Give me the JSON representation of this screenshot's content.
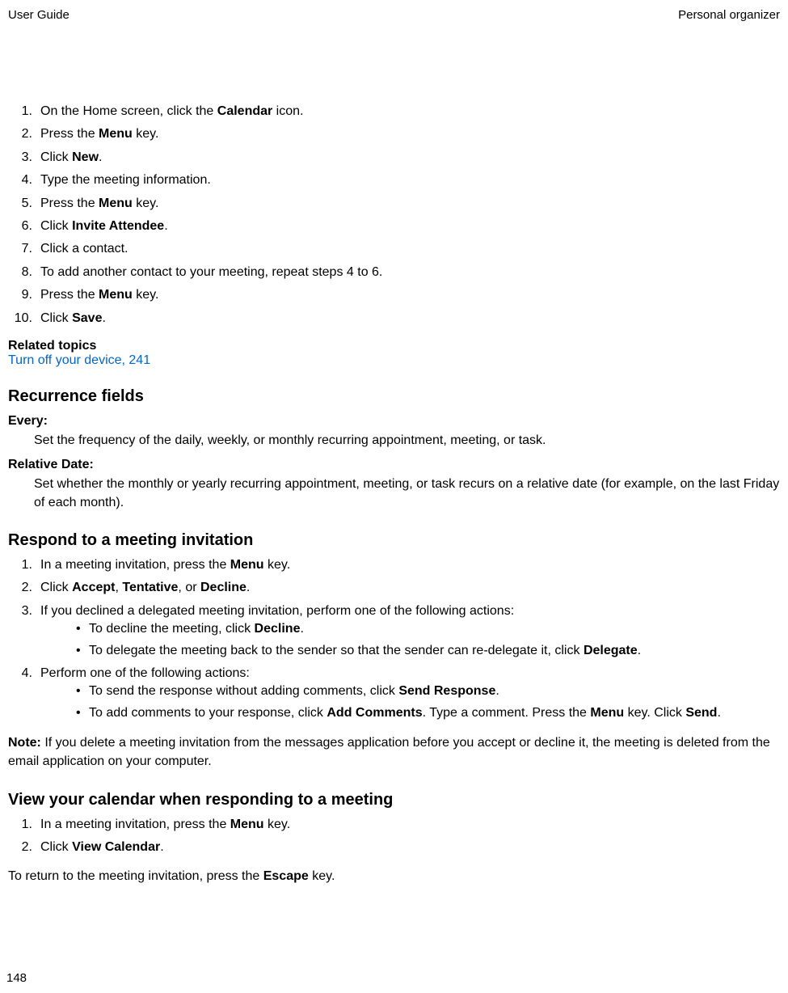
{
  "header": {
    "left": "User Guide",
    "right": "Personal organizer"
  },
  "steps1": [
    {
      "pre": "On the Home screen, click the ",
      "bold": "Calendar",
      "post": " icon."
    },
    {
      "pre": "Press the ",
      "bold": "Menu",
      "post": " key."
    },
    {
      "pre": "Click ",
      "bold": "New",
      "post": "."
    },
    {
      "pre": "Type the meeting information.",
      "bold": "",
      "post": ""
    },
    {
      "pre": "Press the ",
      "bold": "Menu",
      "post": " key."
    },
    {
      "pre": "Click ",
      "bold": "Invite Attendee",
      "post": "."
    },
    {
      "pre": "Click a contact.",
      "bold": "",
      "post": ""
    },
    {
      "pre": "To add another contact to your meeting, repeat steps 4 to 6.",
      "bold": "",
      "post": ""
    },
    {
      "pre": "Press the ",
      "bold": "Menu",
      "post": " key."
    },
    {
      "pre": "Click ",
      "bold": "Save",
      "post": "."
    }
  ],
  "related": {
    "heading": "Related topics",
    "link": "Turn off your device, 241"
  },
  "sectionRecurrence": {
    "title": "Recurrence fields",
    "every": {
      "term": "Every:",
      "def": "Set the frequency of the daily, weekly, or monthly recurring appointment, meeting, or task."
    },
    "relativeDate": {
      "term": "Relative Date:",
      "def": "Set whether the monthly or yearly recurring appointment, meeting, or task recurs on a relative date (for example, on the last Friday of each month)."
    }
  },
  "sectionRespond": {
    "title": "Respond to a meeting invitation",
    "step1": {
      "pre": "In a meeting invitation, press the ",
      "b1": "Menu",
      "post": " key."
    },
    "step2": {
      "pre": "Click ",
      "b1": "Accept",
      "mid1": ", ",
      "b2": "Tentative",
      "mid2": ", or ",
      "b3": "Decline",
      "post": "."
    },
    "step3": {
      "text": "If you declined a delegated meeting invitation, perform one of the following actions:",
      "bullet1": {
        "pre": "To decline the meeting, click ",
        "b1": "Decline",
        "post": "."
      },
      "bullet2": {
        "pre": "To delegate the meeting back to the sender so that the sender can re-delegate it, click ",
        "b1": "Delegate",
        "post": "."
      }
    },
    "step4": {
      "text": "Perform one of the following actions:",
      "bullet1": {
        "pre": "To send the response without adding comments, click ",
        "b1": "Send Response",
        "post": "."
      },
      "bullet2": {
        "pre": "To add comments to your response, click ",
        "b1": "Add Comments",
        "mid1": ". Type a comment. Press the ",
        "b2": "Menu",
        "mid2": " key. Click ",
        "b3": "Send",
        "post": "."
      }
    },
    "note": {
      "label": "Note:",
      "text": "  If you delete a meeting invitation from the messages application before you accept or decline it, the meeting is deleted from the email application on your computer."
    }
  },
  "sectionView": {
    "title": "View your calendar when responding to a meeting",
    "step1": {
      "pre": "In a meeting invitation, press the ",
      "b1": "Menu",
      "post": " key."
    },
    "step2": {
      "pre": "Click ",
      "b1": "View Calendar",
      "post": "."
    },
    "para": {
      "pre": "To return to the meeting invitation, press the ",
      "b1": "Escape",
      "post": " key."
    }
  },
  "pageNumber": "148"
}
